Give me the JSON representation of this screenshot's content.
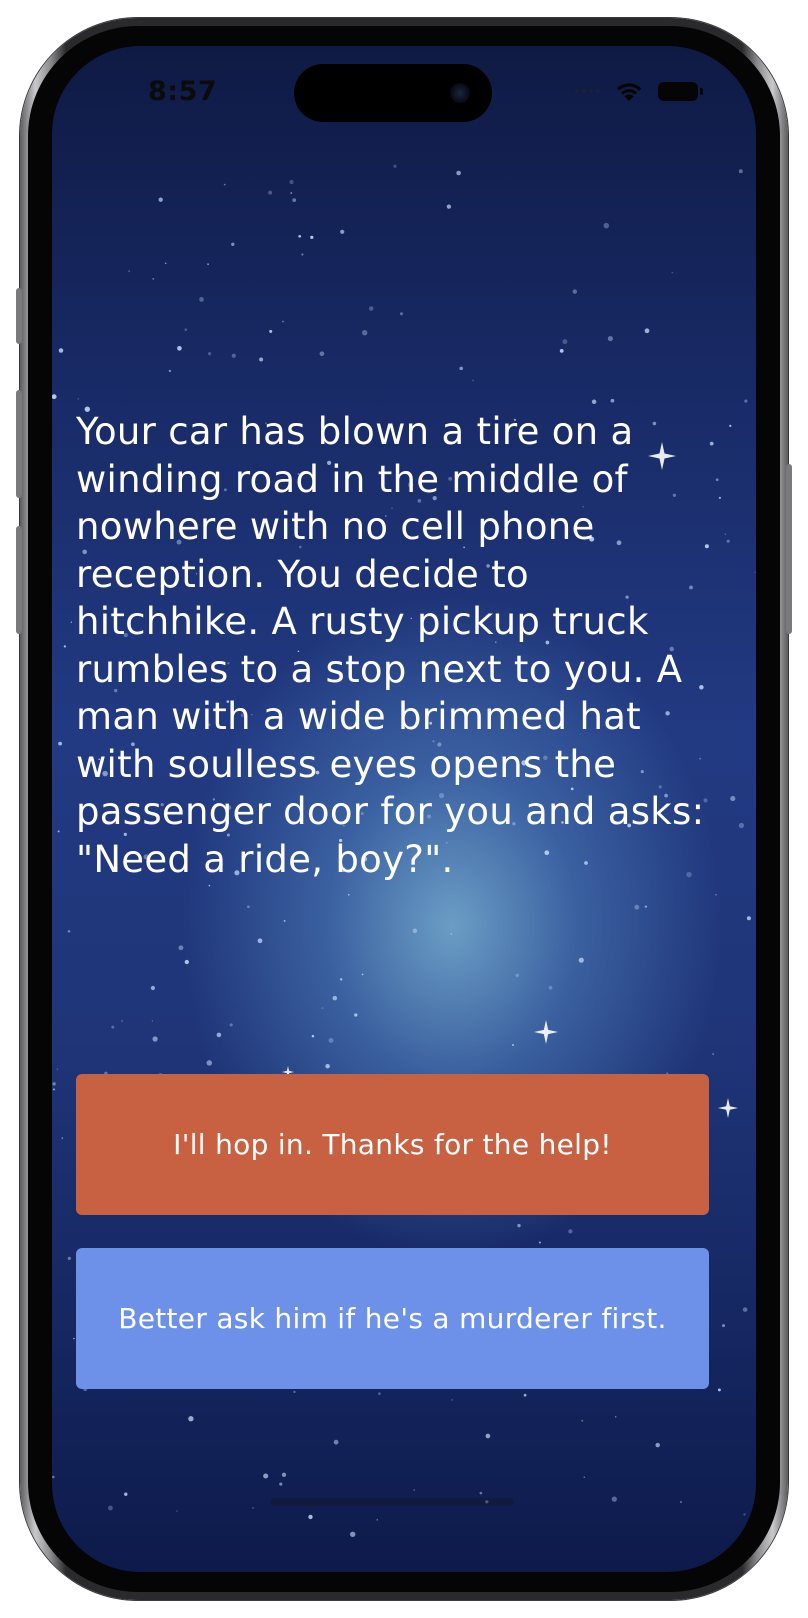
{
  "status_bar": {
    "time": "8:57",
    "icons": [
      "cellular-signal-icon",
      "wifi-icon",
      "battery-icon"
    ]
  },
  "story": {
    "text": "Your car has blown a tire on a winding road in the middle of nowhere with no cell phone reception. You decide to hitchhike. A rusty pickup truck rumbles to a stop next to you. A man with a wide brimmed hat with soulless eyes opens the passenger door for you and asks: \"Need a ride, boy?\"."
  },
  "choices": [
    {
      "label": "I'll hop in. Thanks for the help!",
      "color": "#c86042"
    },
    {
      "label": "Better ask him if he's a murderer first.",
      "color": "#6d90e8"
    }
  ],
  "colors": {
    "background_top": "#0f1a44",
    "background_mid": "#223a82",
    "glow": "#78afd2",
    "text": "#ffffff"
  }
}
